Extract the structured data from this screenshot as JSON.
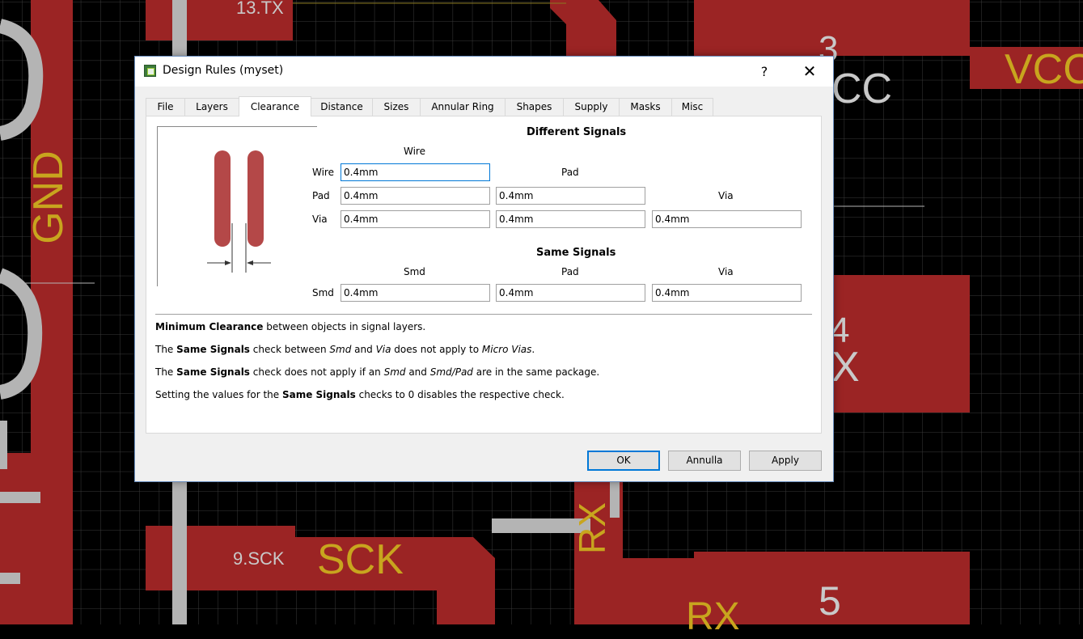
{
  "background": {
    "labels": {
      "tx13": "13.TX",
      "vcc": "VCC",
      "cc": "CC",
      "pin3": "3",
      "gnd": "GND",
      "pin4": "4",
      "x": "X",
      "sck9": "9.SCK",
      "sck": "SCK",
      "rx_vertical": "RX",
      "pin5": "5",
      "rx_bottom": "RX"
    },
    "colors": {
      "copper": "#9b2424",
      "silk": "#c8a51e",
      "grid": "#3c3c3c",
      "wire_gray": "#b4b4b4"
    }
  },
  "dialog": {
    "title": "Design Rules (myset)",
    "help_label": "?",
    "close_label": "✕",
    "tabs": [
      {
        "label": "File"
      },
      {
        "label": "Layers"
      },
      {
        "label": "Clearance"
      },
      {
        "label": "Distance"
      },
      {
        "label": "Sizes"
      },
      {
        "label": "Annular Ring"
      },
      {
        "label": "Shapes"
      },
      {
        "label": "Supply"
      },
      {
        "label": "Masks"
      },
      {
        "label": "Misc"
      }
    ],
    "active_tab": "Clearance",
    "different": {
      "title": "Different Signals",
      "col_wire": "Wire",
      "col_pad": "Pad",
      "col_via": "Via",
      "row_wire": "Wire",
      "row_pad": "Pad",
      "row_via": "Via",
      "wire_wire": "0.4mm",
      "pad_wire": "0.4mm",
      "pad_pad": "0.4mm",
      "via_wire": "0.4mm",
      "via_pad": "0.4mm",
      "via_via": "0.4mm"
    },
    "same": {
      "title": "Same Signals",
      "col_smd": "Smd",
      "col_pad": "Pad",
      "col_via": "Via",
      "row_smd": "Smd",
      "smd_smd": "0.4mm",
      "smd_pad": "0.4mm",
      "smd_via": "0.4mm"
    },
    "notes": {
      "n1_b1": "Minimum Clearance",
      "n1_t1": " between objects in signal layers.",
      "n2_t1": "The ",
      "n2_b1": "Same Signals",
      "n2_t2": " check between ",
      "n2_i1": "Smd",
      "n2_t3": " and ",
      "n2_i2": "Via",
      "n2_t4": " does not apply to ",
      "n2_i3": "Micro Vias",
      "n2_t5": ".",
      "n3_t1": "The ",
      "n3_b1": "Same Signals",
      "n3_t2": " check does not apply if an ",
      "n3_i1": "Smd",
      "n3_t3": " and ",
      "n3_i2": "Smd/Pad",
      "n3_t4": " are in the same package.",
      "n4_t1": "Setting the values for the ",
      "n4_b1": "Same Signals",
      "n4_t2": " checks to 0 disables the respective check."
    },
    "buttons": {
      "ok": "OK",
      "cancel": "Annulla",
      "apply": "Apply"
    }
  }
}
